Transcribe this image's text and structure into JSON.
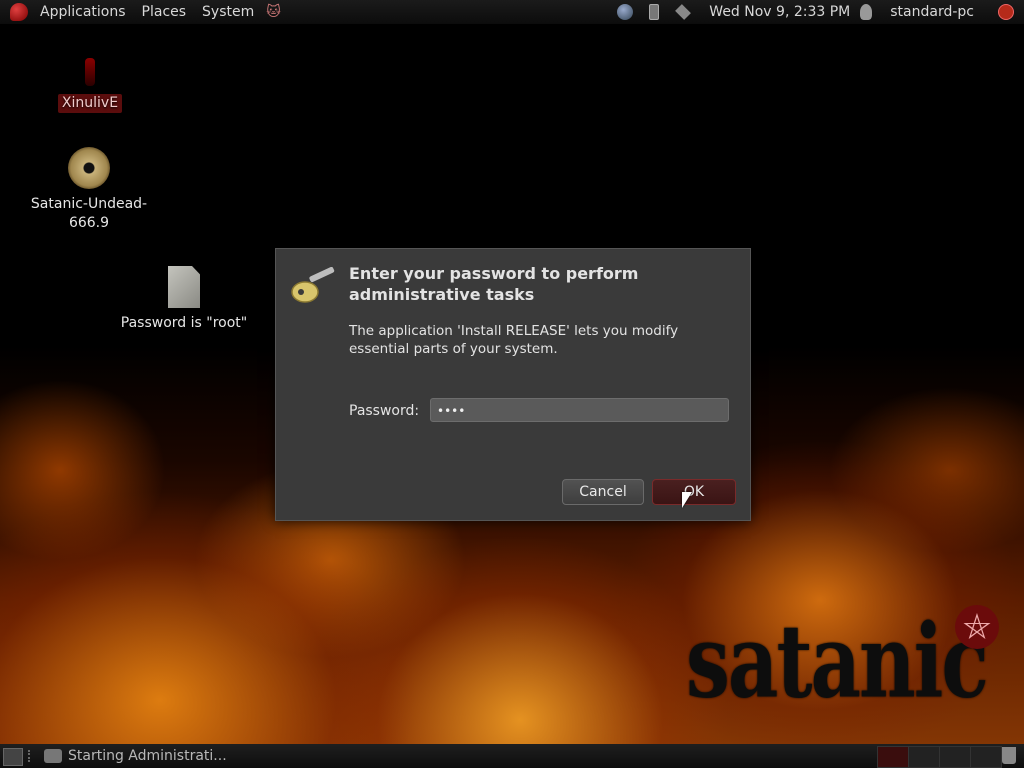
{
  "top_panel": {
    "menus": [
      "Applications",
      "Places",
      "System"
    ],
    "clock": "Wed Nov 9,  2:33 PM",
    "user": "standard-pc"
  },
  "desktop_icons": {
    "home": "XinulivE",
    "disc": "Satanic-Undead-\n666.9",
    "disc_line1": "Satanic-Undead-",
    "disc_line2": "666.9",
    "note": "Password is \"root\""
  },
  "dialog": {
    "title": "Enter your password to perform administrative tasks",
    "description": "The application 'Install RELEASE' lets you modify essential parts of your system.",
    "password_label": "Password:",
    "password_value": "••••",
    "cancel_label": "Cancel",
    "ok_label": "OK"
  },
  "brand": {
    "logo_text": "satanic",
    "symbol": "⛤"
  },
  "bottom_panel": {
    "task_label": "Starting Administrati..."
  },
  "colors": {
    "accent": "#7a2a2a",
    "panel": "#141414",
    "dialog_bg": "#3a3a3a"
  }
}
